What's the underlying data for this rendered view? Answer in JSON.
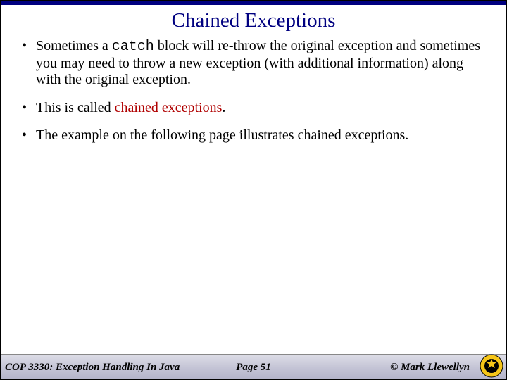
{
  "title": "Chained Exceptions",
  "bullets": {
    "b1_pre": "Sometimes a ",
    "b1_code": "catch",
    "b1_post": " block will re-throw the original exception and sometimes you may need to throw a new exception (with additional information) along with the original exception.",
    "b2_pre": "This is called ",
    "b2_emph": "chained exceptions",
    "b2_post": ".",
    "b3": "The example on the following page illustrates chained exceptions."
  },
  "footer": {
    "course": "COP 3330:  Exception Handling In Java",
    "page": "Page 51",
    "author": "© Mark Llewellyn"
  }
}
